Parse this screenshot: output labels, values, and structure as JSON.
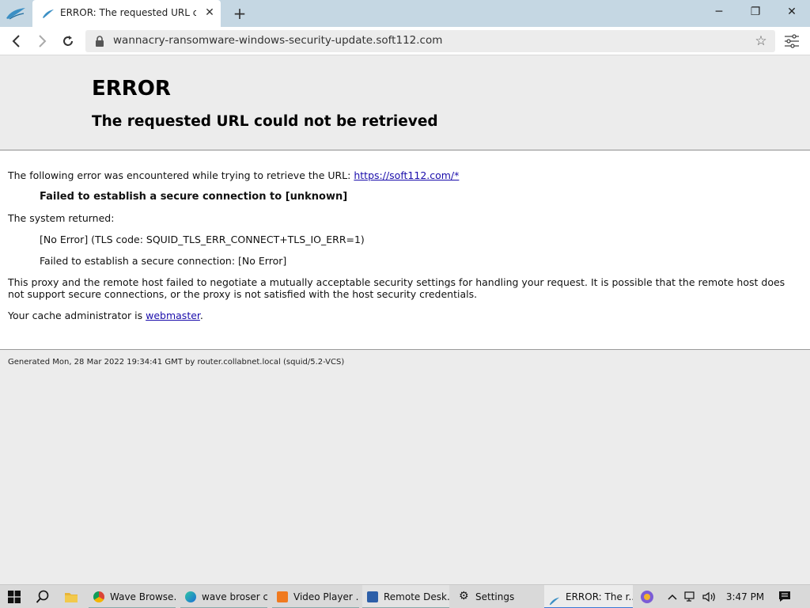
{
  "tab": {
    "title": "ERROR: The requested URL could not be retrieved"
  },
  "window": {
    "minimize": "─",
    "maximize": "❐",
    "close": "✕"
  },
  "toolbar": {
    "url": "wannacry-ransomware-windows-security-update.soft112.com"
  },
  "page": {
    "title": "ERROR",
    "subtitle": "The requested URL could not be retrieved",
    "intro": "The following error was encountered while trying to retrieve the URL:",
    "intro_link": "https://soft112.com/*",
    "error_bold": "Failed to establish a secure connection to [unknown]",
    "system_returned": "The system returned:",
    "system_line1": "[No Error] (TLS code: SQUID_TLS_ERR_CONNECT+TLS_IO_ERR=1)",
    "system_line2": "Failed to establish a secure connection: [No Error]",
    "explanation": "This proxy and the remote host failed to negotiate a mutually acceptable security settings for handling your request. It is possible that the remote host does not support secure connections, or the proxy is not satisfied with the host security credentials.",
    "admin_prefix": "Your cache administrator is ",
    "admin_link": "webmaster",
    "admin_suffix": ".",
    "footer": "Generated Mon, 28 Mar 2022 19:34:41 GMT by router.collabnet.local (squid/5.2-VCS)"
  },
  "taskbar": {
    "items": [
      {
        "label": "Wave Browse..."
      },
      {
        "label": "wave broser c..."
      },
      {
        "label": "Video Player ..."
      },
      {
        "label": "Remote Desk..."
      },
      {
        "label": "Settings"
      },
      {
        "label": "ERROR: The r..."
      }
    ],
    "time": "3:47 PM"
  },
  "colors": {
    "accent": "#1a0dab",
    "titlebar": "#c5d7e3"
  }
}
